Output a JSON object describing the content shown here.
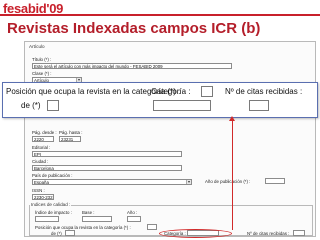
{
  "logo": "fesabid'09",
  "slide_title": "Revistas Indexadas campos ICR (b)",
  "form": {
    "legend_articulo": "Artículo",
    "titulo_label": "Título (*) :",
    "titulo_value": "Este será el artículo con más impacto del mundo - FESABID 2009",
    "clase_label": "Clase (*) :",
    "clase_value": "Artículo",
    "pag_desde_label": "Pág. desde :",
    "pag_desde_value": "2220",
    "pag_hasta_label": "Pág. hasta :",
    "pag_hasta_value": "23231",
    "editorial_label": "Editorial :",
    "editorial_value": "EPI",
    "ciudad_label": "Ciudad :",
    "ciudad_value": "Barcelona",
    "pais_label": "País de publicación :",
    "pais_value": "España",
    "anio_pub_label": "Año de publicación (*) :",
    "issn_label": "ISSN :",
    "issn_value": "2230-2321",
    "legend_indices": "Indices de calidad :",
    "indice_impacto_label": "Índice de impacto :",
    "base_label": "Base :",
    "anio_label": "Año :",
    "posicion_label": "Posición que ocupa la revista en la categoría (*) :",
    "posicion_de": "de (*)",
    "categoria_label": "Categoría :",
    "citas_label": "Nº de citas recibidas :"
  },
  "zoom": {
    "posicion_label": "Posición que ocupa la revista en la categoría (*) :",
    "de_label": "de (*)",
    "categoria_label": "Categoría :",
    "citas_label": "Nº de citas recibidas :"
  }
}
